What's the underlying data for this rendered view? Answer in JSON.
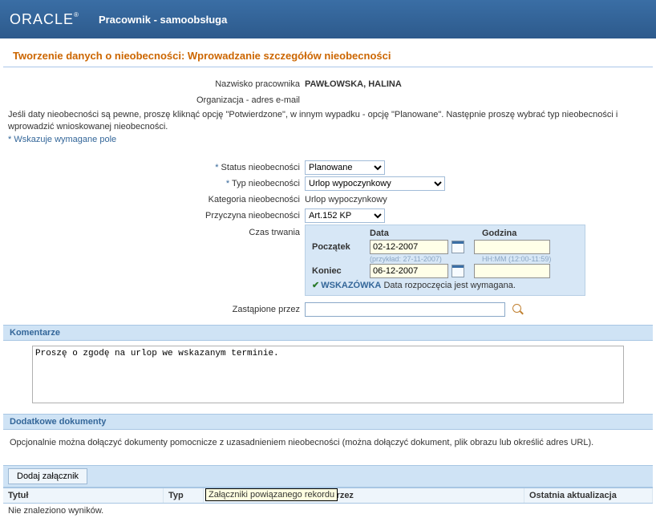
{
  "header": {
    "logo_text": "ORACLE",
    "logo_reg": "®",
    "subtitle": "Pracownik - samoobsługa"
  },
  "page_title": "Tworzenie danych o nieobecności: Wprowadzanie szczegółów nieobecności",
  "employee": {
    "name_label": "Nazwisko pracownika",
    "name_value": "PAWŁOWSKA, HALINA",
    "email_label": "Organizacja - adres e-mail"
  },
  "instructions": "Jeśli daty nieobecności są pewne, proszę kliknąć opcję \"Potwierdzone\", w innym wypadku - opcję \"Planowane\". Następnie proszę wybrać typ nieobecności i wprowadzić wnioskowanej nieobecności.",
  "required_note_prefix": "*",
  "required_note": "Wskazuje wymagane pole",
  "fields": {
    "status_label": "Status nieobecności",
    "status_value": "Planowane",
    "type_label": "Typ nieobecności",
    "type_value": "Urlop wypoczynkowy",
    "category_label": "Kategoria nieobecności",
    "category_value": "Urlop wypoczynkowy",
    "reason_label": "Przyczyna nieobecności",
    "reason_value": "Art.152 KP",
    "duration_label": "Czas trwania",
    "replaced_label": "Zastąpione przez",
    "replaced_value": ""
  },
  "duration": {
    "date_header": "Data",
    "time_header": "Godzina",
    "start_label": "Początek",
    "start_date": "02-12-2007",
    "start_time": "",
    "date_example": "(przykład: 27-11-2007)",
    "time_example": "HH:MM (12:00-11:59)",
    "end_label": "Koniec",
    "end_date": "06-12-2007",
    "end_time": "",
    "tip_label": "WSKAZÓWKA",
    "tip_text": "Data rozpoczęcia jest wymagana."
  },
  "comments": {
    "header": "Komentarze",
    "text": "Proszę o zgodę na urlop we wskazanym terminie."
  },
  "docs": {
    "header": "Dodatkowe dokumenty",
    "description": "Opcjonalnie można dołączyć dokumenty pomocnicze z uzasadnieniem nieobecności (można dołączyć dokument, plik obrazu lub określić adres URL).",
    "add_button": "Dodaj załącznik",
    "tooltip": "Załączniki powiązanego rekordu",
    "th_title": "Tytuł",
    "th_type": "Typ",
    "th_desc_prefix": "O",
    "th_updated_by_suffix": "tnio aktualizowane przez",
    "th_updated_at": "Ostatnia aktualizacja",
    "no_results": "Nie znaleziono wyników."
  }
}
